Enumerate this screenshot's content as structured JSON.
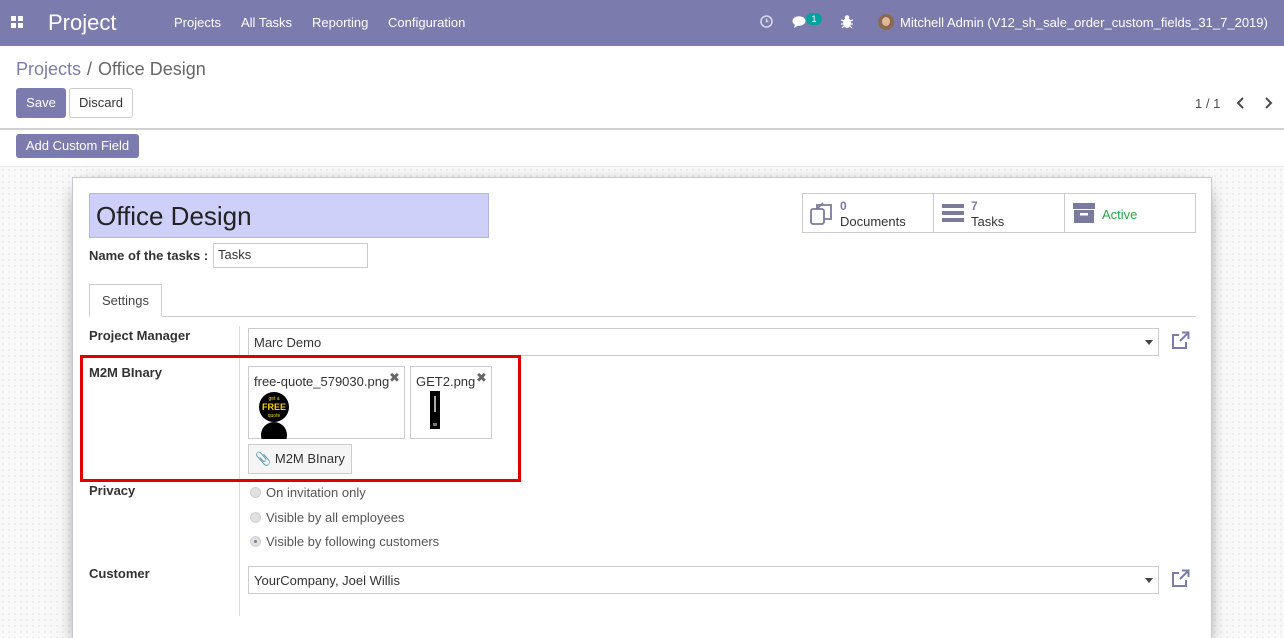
{
  "navbar": {
    "brand": "Project",
    "menu": [
      "Projects",
      "All Tasks",
      "Reporting",
      "Configuration"
    ],
    "chat_badge": "1",
    "user": "Mitchell Admin (V12_sh_sale_order_custom_fields_31_7_2019)"
  },
  "breadcrumb": {
    "parent": "Projects",
    "separator": "/",
    "current": "Office Design"
  },
  "actions": {
    "save": "Save",
    "discard": "Discard",
    "add_custom_field": "Add Custom Field"
  },
  "pager": {
    "value": "1 / 1",
    "prev": "‹",
    "next": "›"
  },
  "form": {
    "project_name": "Office Design",
    "tasks_label": "Name of the tasks :",
    "tasks_value": "Tasks",
    "stat_buttons": {
      "documents": {
        "value": "0",
        "label": "Documents"
      },
      "tasks": {
        "value": "7",
        "label": "Tasks"
      },
      "active": {
        "label": "Active"
      }
    },
    "tab": "Settings",
    "project_manager": {
      "label": "Project Manager",
      "value": "Marc Demo"
    },
    "m2m_binary": {
      "label": "M2M BInary",
      "files": [
        "free-quote_579030.png",
        "GET2.png"
      ],
      "remove_glyph": "✖",
      "upload_label": "M2M BInary",
      "thumb_text": {
        "top": "get a",
        "main": "FREE",
        "bottom": "quote"
      }
    },
    "privacy": {
      "label": "Privacy",
      "options": [
        "On invitation only",
        "Visible by all employees",
        "Visible by following customers"
      ],
      "selected": "Visible by following customers"
    },
    "customer": {
      "label": "Customer",
      "value": "YourCompany, Joel Willis"
    }
  },
  "colors": {
    "navbar": "#7c7bad",
    "title_bg": "#cfd0f9",
    "active_green": "#28a745",
    "highlight": "#e00000"
  },
  "icons": [
    "apps-grid-icon",
    "clock-icon",
    "chat-icon",
    "bug-icon",
    "documents-icon",
    "tasks-icon",
    "archive-icon",
    "external-link-icon",
    "paperclip-icon"
  ]
}
